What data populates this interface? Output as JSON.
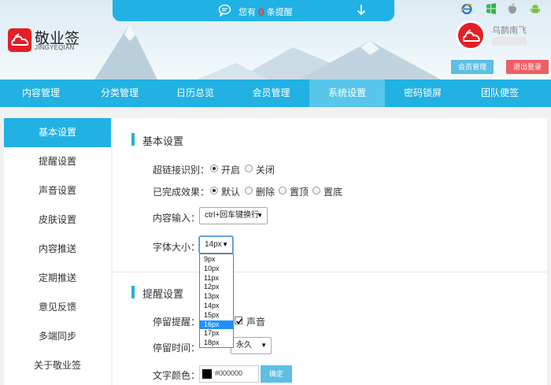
{
  "notification": {
    "prefix": "您有",
    "count": "0",
    "suffix": "条提醒"
  },
  "logo": {
    "cn": "敬业签",
    "en": "JINGYEQIAN"
  },
  "user": {
    "name": "乌鹊南飞",
    "member_btn": "会员管理",
    "logout_btn": "退出登录"
  },
  "nav": [
    "内容管理",
    "分类管理",
    "日历总览",
    "会员管理",
    "系统设置",
    "密码锁屏",
    "团队便签"
  ],
  "nav_active": "系统设置",
  "sidebar": [
    "基本设置",
    "提醒设置",
    "声音设置",
    "皮肤设置",
    "内容推送",
    "定期推送",
    "意见反馈",
    "多端同步",
    "关于敬业签"
  ],
  "sidebar_active": "基本设置",
  "basic": {
    "title": "基本设置",
    "link_label": "超链接识别：",
    "link_opts": [
      "开启",
      "关闭"
    ],
    "done_label": "已完成效果：",
    "done_opts": [
      "默认",
      "删除",
      "置顶",
      "置底"
    ],
    "input_label": "内容输入：",
    "input_value": "ctrl+回车键换行",
    "font_label": "字体大小：",
    "font_value": "14px",
    "font_options": [
      "9px",
      "10px",
      "11px",
      "12px",
      "13px",
      "14px",
      "15px",
      "16px",
      "17px",
      "18px"
    ],
    "font_highlight": "16px"
  },
  "remind": {
    "title": "提醒设置",
    "stay_label": "停留提醒：",
    "sound_label": "声音",
    "stay_time_label": "停留时间：",
    "stay_time_value": "永久",
    "color_label": "文字颜色：",
    "color_hex": "#000000",
    "confirm": "确定"
  },
  "colors": {
    "accent": "#21b2e3",
    "brand": "#e71d25",
    "logout": "#ed5f64"
  }
}
